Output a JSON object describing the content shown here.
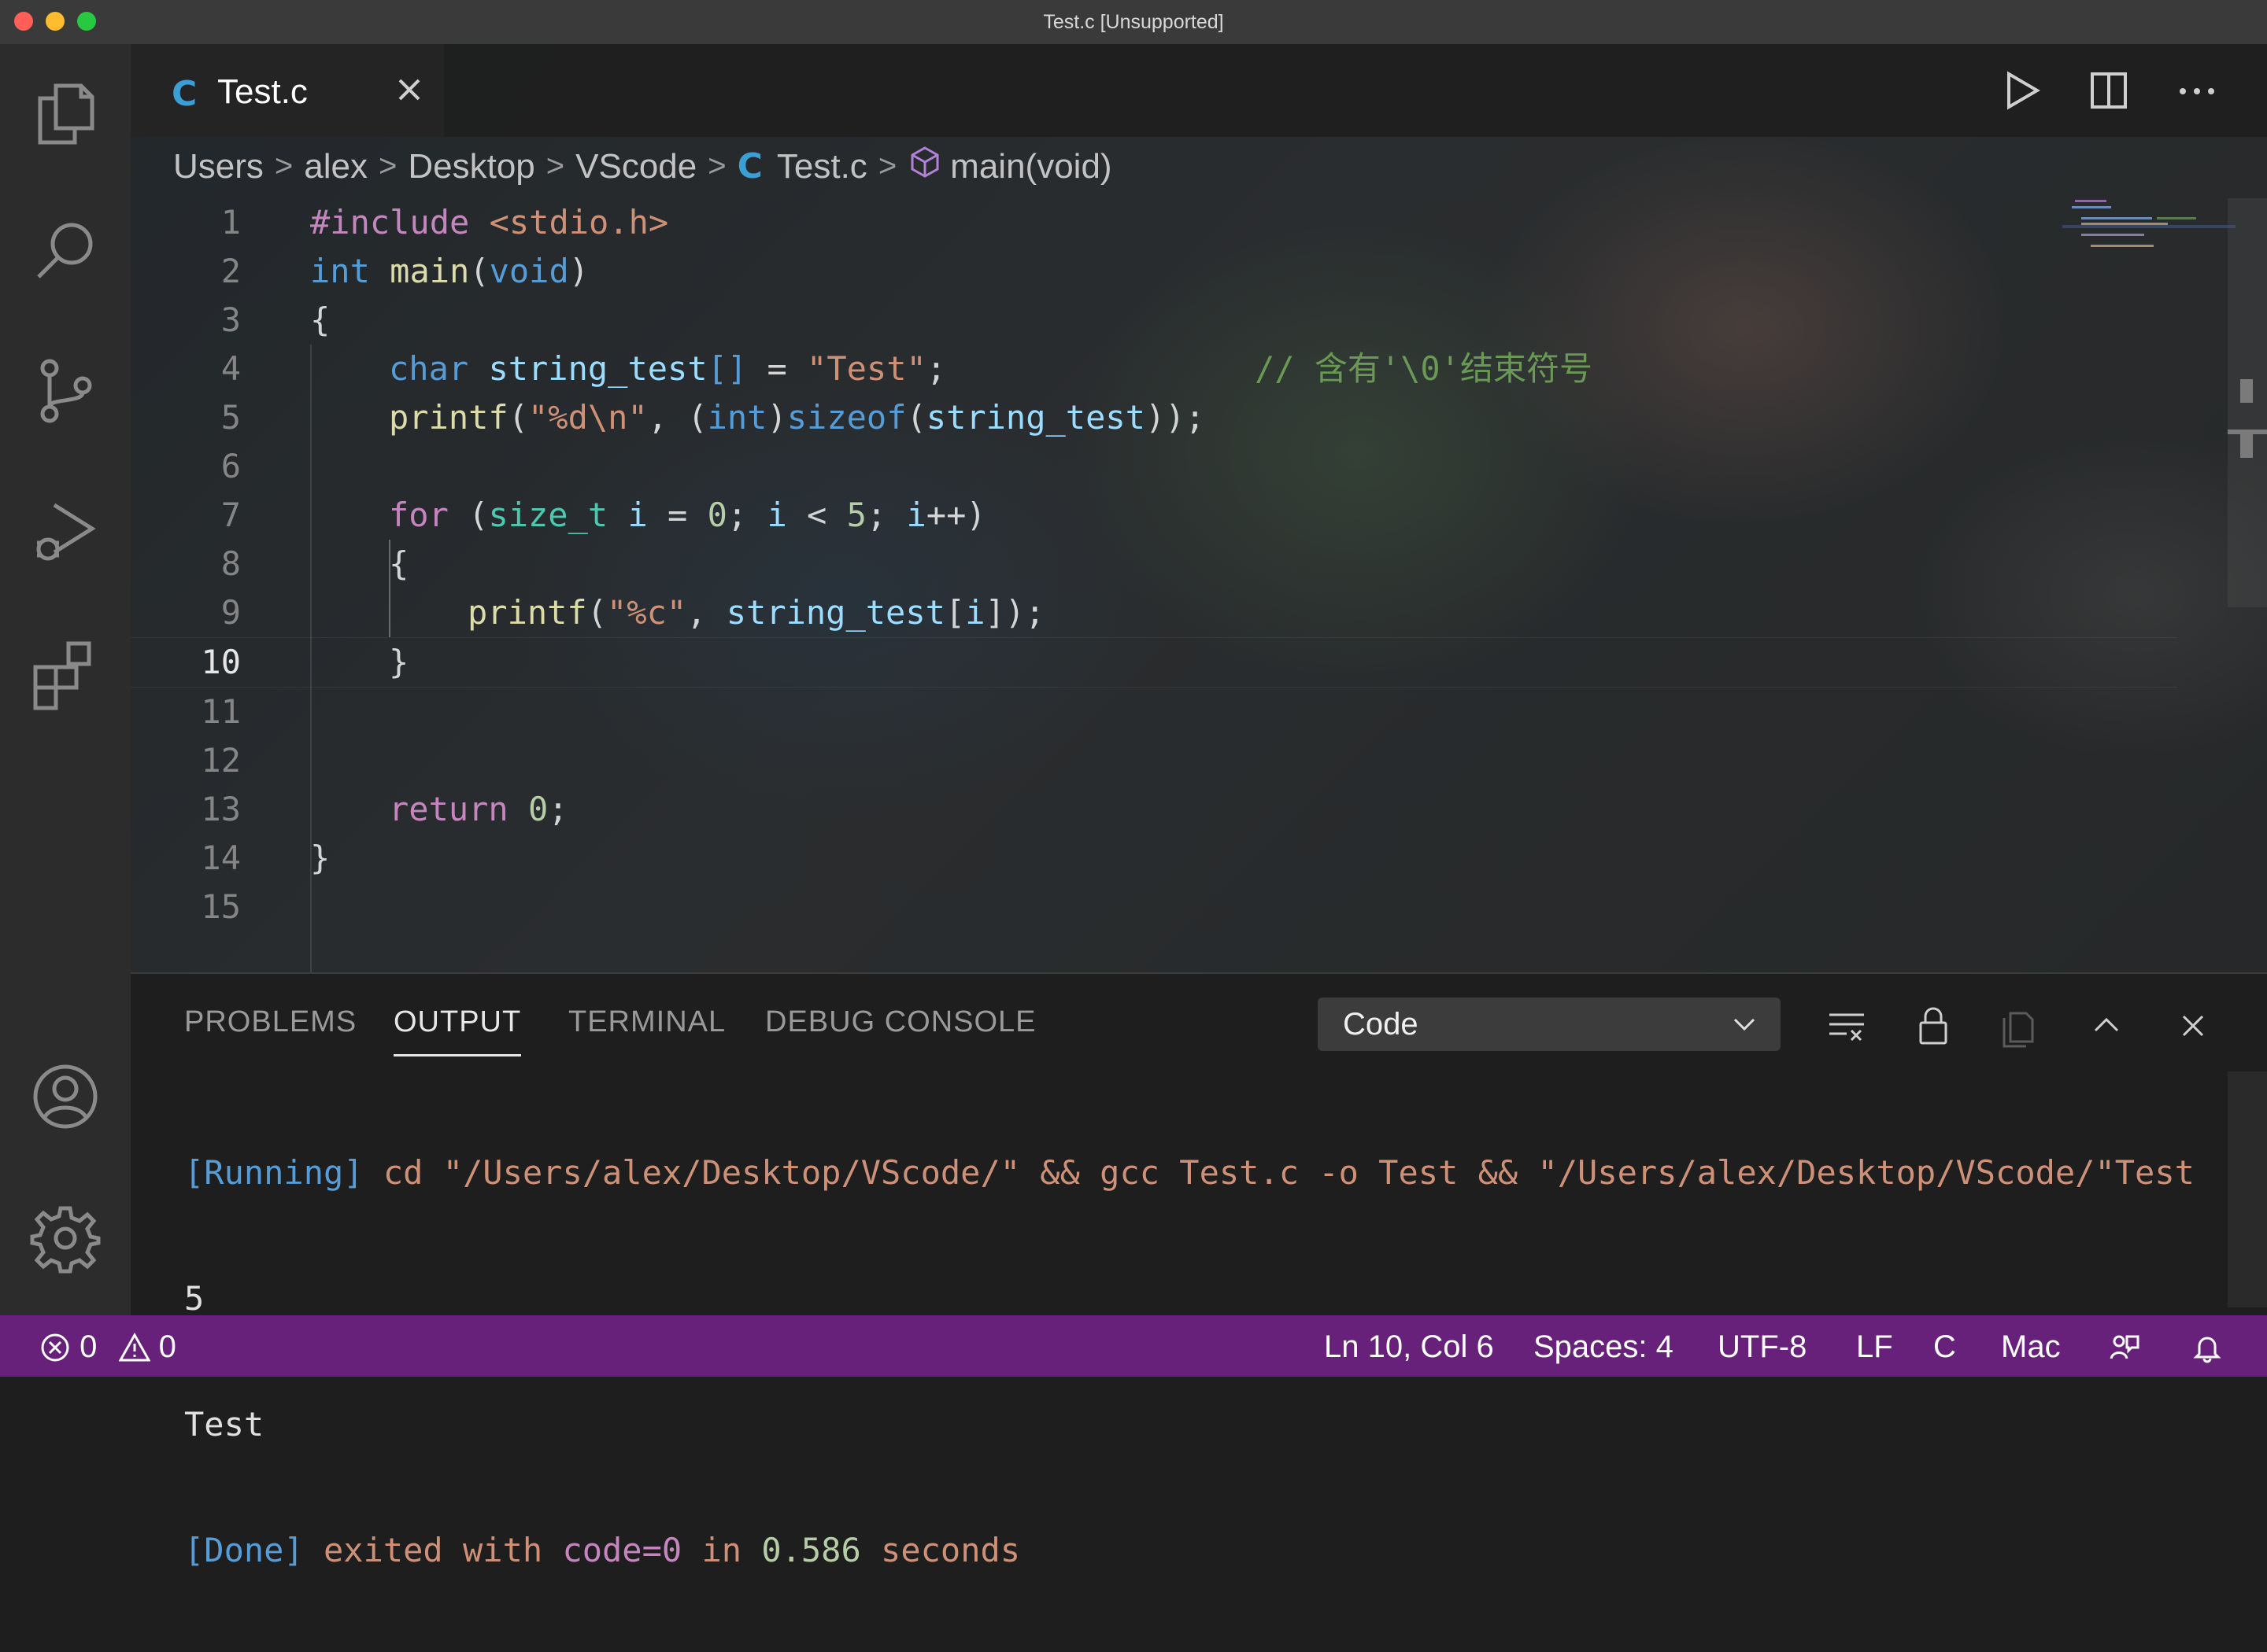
{
  "window": {
    "title": "Test.c [Unsupported]",
    "traffic_colors": [
      "#ff5f57",
      "#febc2e",
      "#28c840"
    ]
  },
  "activity_bar": {
    "items": [
      "files-icon",
      "search-icon",
      "source-control-icon",
      "run-debug-icon",
      "extensions-icon"
    ],
    "bottom": [
      "account-icon",
      "settings-gear-icon"
    ]
  },
  "tab": {
    "icon_char": "C",
    "label": "Test.c"
  },
  "breadcrumb": {
    "items": [
      "Users",
      "alex",
      "Desktop",
      "VScode"
    ],
    "file_icon": "C",
    "file": "Test.c",
    "symbol": "main(void)"
  },
  "editor": {
    "active_line": 10,
    "line_numbers": [
      "1",
      "2",
      "3",
      "4",
      "5",
      "6",
      "7",
      "8",
      "9",
      "10",
      "11",
      "12",
      "13",
      "14",
      "15"
    ],
    "lines": {
      "l1": {
        "pp": "#include",
        "hdr": "<stdio.h>"
      },
      "l2": {
        "type": "int",
        "fn": "main",
        "open": "(",
        "void": "void",
        "close": ")"
      },
      "l3": {
        "brace": "{"
      },
      "l4": {
        "type": "char",
        "var": "string_test",
        "arr": "[]",
        "eq": " = ",
        "str": "\"Test\"",
        "semi": ";",
        "comment": "// 含有'\\0'结束符号"
      },
      "l5": {
        "fn": "printf",
        "open": "(",
        "str": "\"%d\\n\"",
        "comma": ", ",
        "cast_open": "(",
        "cast_type": "int",
        "cast_close": ")",
        "sizeof": "sizeof",
        "p1": "(",
        "var": "string_test",
        "end": "));"
      },
      "l7": {
        "kw": "for",
        "open": " (",
        "type": "size_t",
        "i1": " i",
        "eq": " = ",
        "zero": "0",
        "semi1": "; ",
        "i2": "i",
        "lt": " < ",
        "five": "5",
        "semi2": "; ",
        "i3": "i",
        "inc": "++)"
      },
      "l8": {
        "brace": "{"
      },
      "l9": {
        "fn": "printf",
        "open": "(",
        "str": "\"%c\"",
        "comma": ", ",
        "var": "string_test",
        "br1": "[",
        "i": "i",
        "end": "]);"
      },
      "l10": {
        "brace": "}"
      },
      "l13": {
        "kw": "return",
        "sp": " ",
        "num": "0",
        "semi": ";"
      },
      "l14": {
        "brace": "}"
      }
    }
  },
  "panel": {
    "tabs": [
      "PROBLEMS",
      "OUTPUT",
      "TERMINAL",
      "DEBUG CONSOLE"
    ],
    "active_tab": "OUTPUT",
    "channel": "Code",
    "output": {
      "running_tag": "[Running]",
      "command": " cd \"/Users/alex/Desktop/VScode/\" && gcc Test.c -o Test && \"/Users/alex/Desktop/VScode/\"Test",
      "line2": "5",
      "line3": "Test",
      "done_tag": "[Done]",
      "done_a": " exited with ",
      "done_code": "code=0",
      "done_b": " in ",
      "done_secs": "0.586",
      "done_c": " seconds"
    }
  },
  "status_bar": {
    "color": "#68217a",
    "errors": "0",
    "warnings": "0",
    "position": "Ln 10, Col 6",
    "spaces": "Spaces: 4",
    "encoding": "UTF-8",
    "eol": "LF",
    "language": "C",
    "config": "Mac"
  }
}
